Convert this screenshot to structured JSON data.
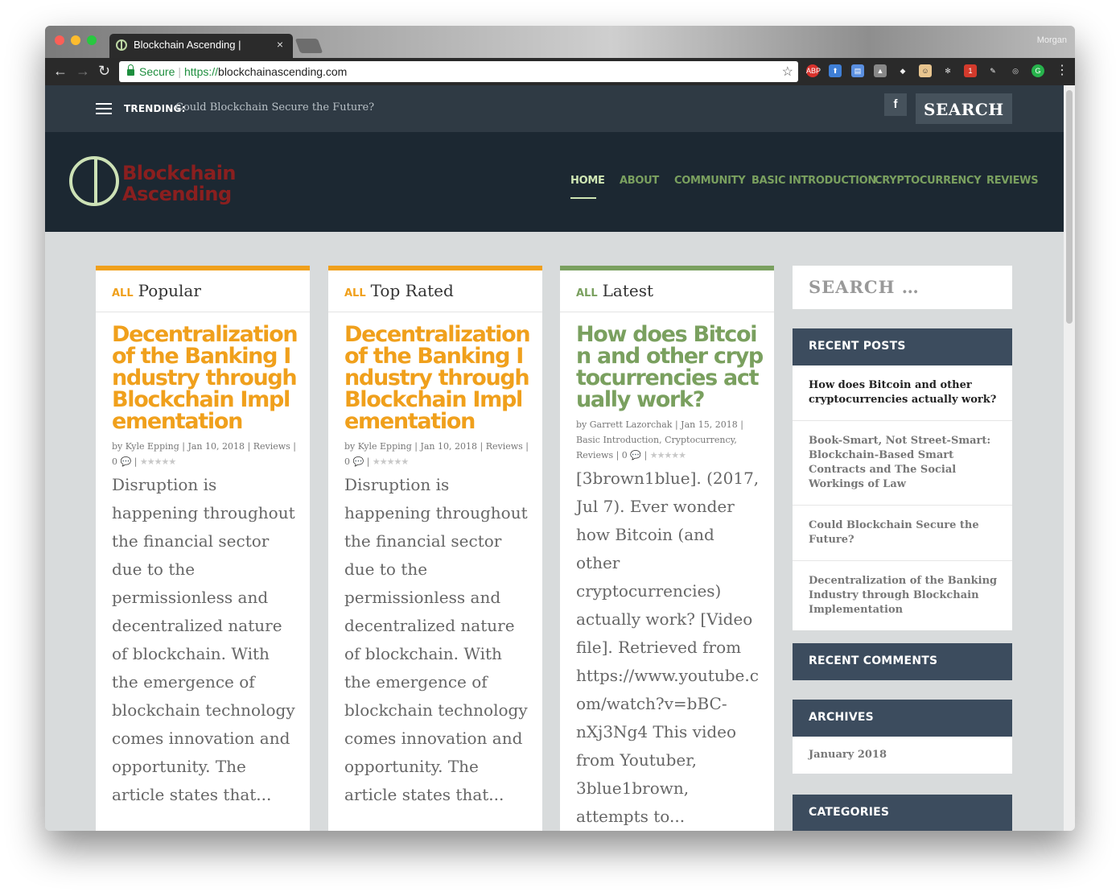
{
  "browser": {
    "tab_title": "Blockchain Ascending |",
    "tab_close": "×",
    "user_name": "Morgan",
    "secure_label": "Secure",
    "url_scheme": "https://",
    "url_host": "blockchainascending.com"
  },
  "topbar": {
    "trending_label": "TRENDING:",
    "trending_text": "Could Blockchain Secure the Future?",
    "facebook_label": "f",
    "search_label": "SEARCH"
  },
  "header": {
    "logo_line1": "Blockchain",
    "logo_line2": "Ascending",
    "menu": [
      {
        "label": "HOME"
      },
      {
        "label": "ABOUT"
      },
      {
        "label": "COMMUNITY"
      },
      {
        "label": "BASIC INTRODUCTION"
      },
      {
        "label": "CRYPTOCURRENCY"
      },
      {
        "label": "REVIEWS"
      }
    ]
  },
  "columns": [
    {
      "all_label": "ALL",
      "heading": "Popular",
      "accent": "#f0a01c",
      "title": "Decentralization of the Banking Industry through Blockchain Implementation",
      "meta_line1": "by Kyle Epping | Jan 10, 2018 | Reviews |",
      "meta_line2": "0 💬 |",
      "stars": "★★★★★",
      "excerpt": "Disruption is happening throughout the financial sector due to the permissionless and decentralized nature of blockchain.  With the emergence of blockchain technology comes innovation and opportunity.  The article states that..."
    },
    {
      "all_label": "ALL",
      "heading": "Top Rated",
      "accent": "#f0a01c",
      "title": "Decentralization of the Banking Industry through Blockchain Implementation",
      "meta_line1": "by Kyle Epping | Jan 10, 2018 | Reviews |",
      "meta_line2": "0 💬 |",
      "stars": "★★★★★",
      "excerpt": "Disruption is happening throughout the financial sector due to the permissionless and decentralized nature of blockchain.  With the emergence of blockchain technology comes innovation and opportunity.  The article states that..."
    },
    {
      "all_label": "ALL",
      "heading": "Latest",
      "accent": "#7aa05f",
      "title": "How does Bitcoin and other cryptocurrencies actually work?",
      "meta_line1": "by Garrett Lazorchak | Jan 15, 2018 | Basic Introduction, Cryptocurrency,",
      "meta_line2": "Reviews | 0 💬 |",
      "stars": "★★★★★",
      "excerpt": "[3brown1blue]. (2017, Jul 7). Ever wonder how Bitcoin (and other cryptocurrencies) actually work? [Video file]. Retrieved from https://www.youtube.com/watch?v=bBC-nXj3Ng4   This video from Youtuber, 3blue1brown, attempts to..."
    }
  ],
  "sidebar": {
    "search_placeholder": "SEARCH …",
    "recent_posts_title": "RECENT POSTS",
    "recent_posts": [
      "How does Bitcoin and other cryptocurrencies actually work?",
      "Book-Smart, Not Street-Smart: Blockchain-Based Smart Contracts and The Social Workings of Law",
      "Could Blockchain Secure the Future?",
      "Decentralization of the Banking Industry through Blockchain Implementation"
    ],
    "recent_comments_title": "RECENT COMMENTS",
    "archives_title": "ARCHIVES",
    "archives": [
      "January 2018"
    ],
    "categories_title": "CATEGORIES"
  },
  "colors": {
    "orange_accent": "#f0a01c",
    "green_accent": "#7aa05f",
    "header_bg": "#1c2832",
    "topbar_bg": "#2f3a44",
    "widget_head_bg": "#3c4c5e",
    "logo_red": "#8a1f1f"
  }
}
